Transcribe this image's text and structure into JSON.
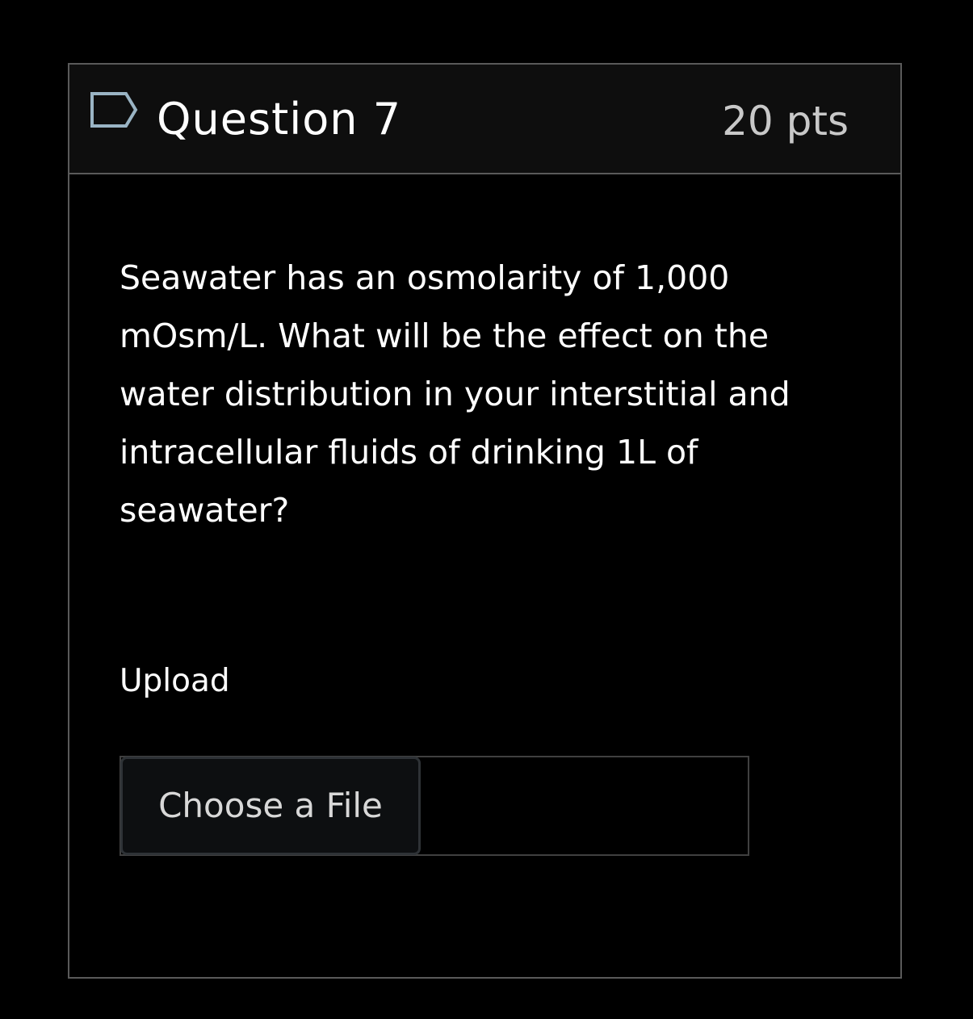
{
  "question": {
    "title": "Question 7",
    "points": "20 pts",
    "flag_icon": "flag-outline-icon",
    "text_lines": [
      "Seawater has an osmolarity of 1,000",
      "mOsm/L.  What will be the effect on the",
      "water distribution in your interstitial and",
      "intracellular fluids of drinking 1L of",
      "seawater?"
    ]
  },
  "upload": {
    "label": "Upload",
    "button_label": "Choose a File",
    "file_name": ""
  },
  "colors": {
    "background": "#000000",
    "header_background": "#0e0e0e",
    "border": "#5a5a5a",
    "flag_stroke": "#9ab4c4",
    "points_text": "#c8c8c8",
    "button_background": "#0d0f11",
    "button_border": "#2e3236"
  }
}
